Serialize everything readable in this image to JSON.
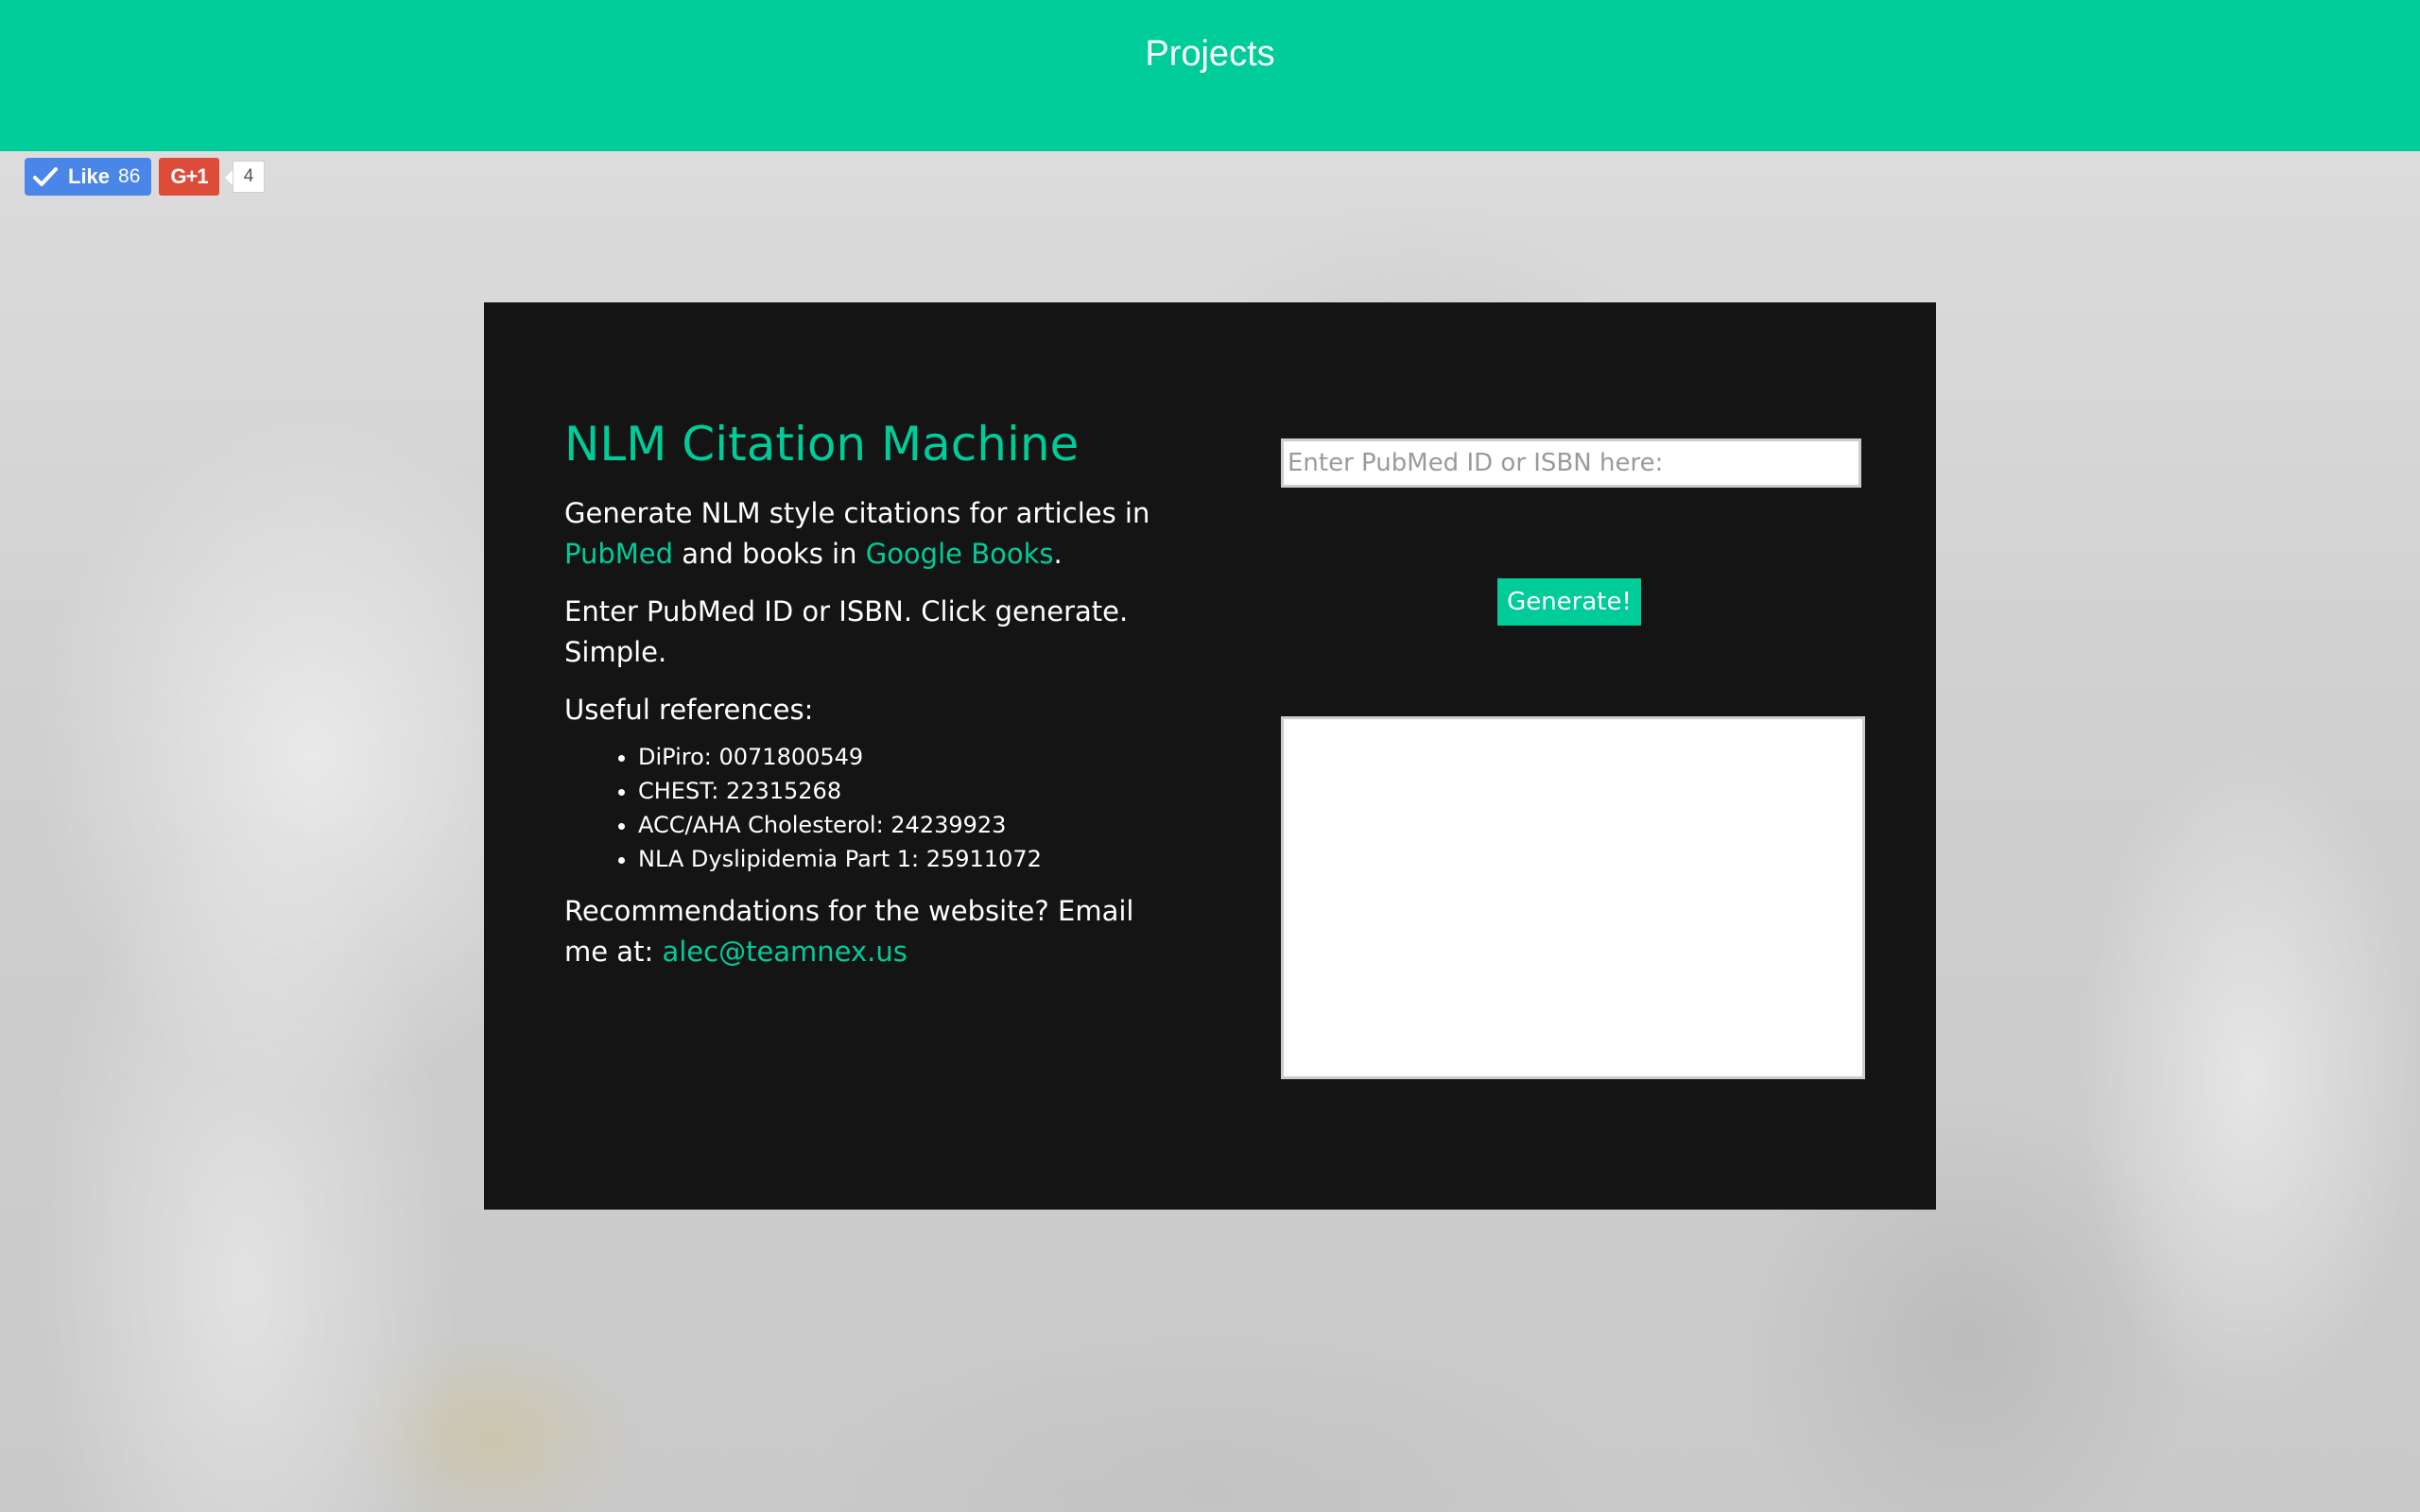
{
  "header": {
    "title": "Projects",
    "background_color": "#00cc99"
  },
  "social": {
    "like_label": "Like",
    "like_count": "86",
    "gplus_label": "G+1",
    "gplus_count": "4"
  },
  "app": {
    "title": "NLM Citation Machine",
    "accent_color": "#00cc99",
    "intro_prefix": "Generate NLM style citations for articles in ",
    "pubmed_link": "PubMed",
    "intro_middle": " and books in ",
    "google_books_link": "Google Books",
    "intro_suffix": ".",
    "instructions": "Enter PubMed ID or ISBN. Click generate. Simple.",
    "references_heading": "Useful references:",
    "references": [
      "DiPiro: 0071800549",
      "CHEST: 22315268",
      "ACC/AHA Cholesterol: 24239923",
      "NLA Dyslipidemia Part 1: 25911072"
    ],
    "contact_prefix": "Recommendations for the website? Email me at: ",
    "contact_email": "alec@teamnex.us"
  },
  "form": {
    "input_placeholder": "Enter PubMed ID or ISBN here:",
    "input_value": "",
    "generate_label": "Generate!",
    "output_value": ""
  }
}
